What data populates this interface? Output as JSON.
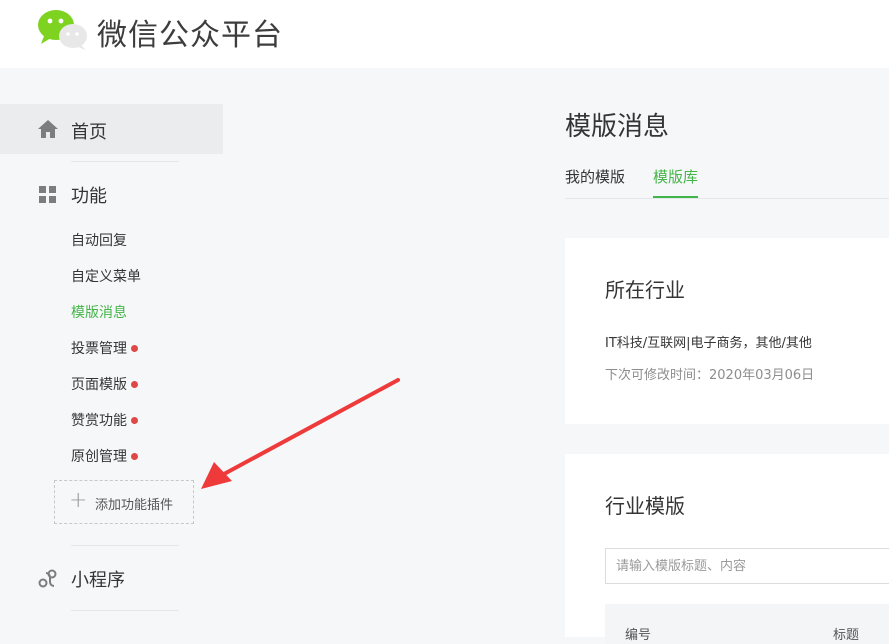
{
  "brand": {
    "name": "微信公众平台"
  },
  "sidebar": {
    "home_label": "首页",
    "feature_label": "功能",
    "sub_items": [
      {
        "label": "自动回复",
        "active": false,
        "dot": false
      },
      {
        "label": "自定义菜单",
        "active": false,
        "dot": false
      },
      {
        "label": "模版消息",
        "active": true,
        "dot": false
      },
      {
        "label": "投票管理",
        "active": false,
        "dot": true
      },
      {
        "label": "页面模版",
        "active": false,
        "dot": true
      },
      {
        "label": "赞赏功能",
        "active": false,
        "dot": true
      },
      {
        "label": "原创管理",
        "active": false,
        "dot": true
      }
    ],
    "add_plugin_label": "添加功能插件",
    "miniprogram_label": "小程序"
  },
  "main": {
    "title": "模版消息",
    "tabs": [
      {
        "label": "我的模版",
        "active": false
      },
      {
        "label": "模版库",
        "active": true
      }
    ],
    "industry_card": {
      "title": "所在行业",
      "industry": "IT科技/互联网|电子商务，其他/其他",
      "modify_time": "下次可修改时间：2020年03月06日"
    },
    "template_card": {
      "title": "行业模版",
      "search_placeholder": "请输入模版标题、内容",
      "columns": [
        "编号",
        "标题"
      ]
    }
  },
  "colors": {
    "accent": "#44b549",
    "badge": "#e04848",
    "annotation_arrow": "#ee3a3a"
  }
}
